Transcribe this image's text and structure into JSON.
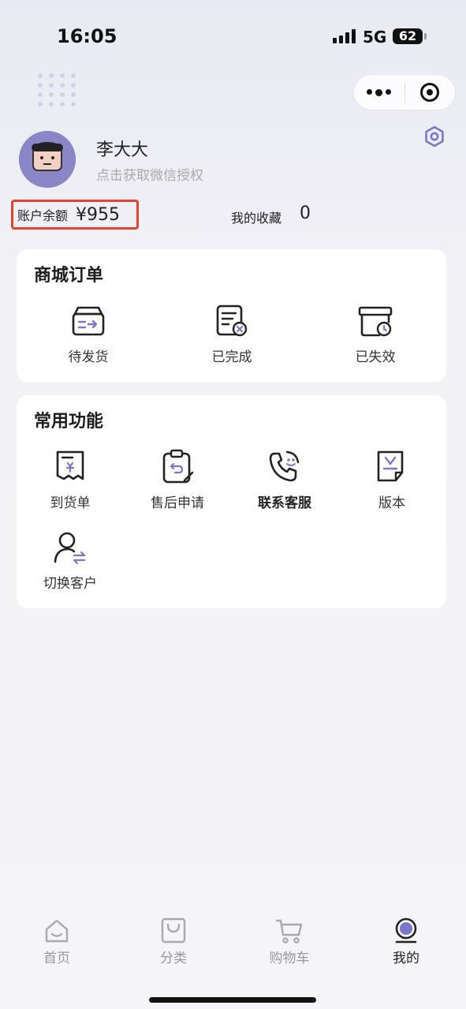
{
  "status_bar": {
    "time": "16:05",
    "network": "5G",
    "battery": "62"
  },
  "profile": {
    "name": "李大大",
    "subtitle": "点击获取微信授权"
  },
  "account": {
    "balance_label": "账户余额",
    "balance_value": "¥955",
    "favorites_label": "我的收藏",
    "favorites_count": "0"
  },
  "orders": {
    "title": "商城订单",
    "items": [
      {
        "label": "待发货",
        "icon": "pending-shipment-icon"
      },
      {
        "label": "已完成",
        "icon": "completed-icon"
      },
      {
        "label": "已失效",
        "icon": "expired-icon"
      }
    ]
  },
  "functions": {
    "title": "常用功能",
    "items": [
      {
        "label": "到货单",
        "icon": "receipt-icon"
      },
      {
        "label": "售后申请",
        "icon": "after-sales-icon"
      },
      {
        "label": "联系客服",
        "icon": "customer-service-icon"
      },
      {
        "label": "版本",
        "icon": "version-icon"
      },
      {
        "label": "切换客户",
        "icon": "switch-customer-icon"
      }
    ]
  },
  "tabbar": {
    "items": [
      {
        "label": "首页",
        "icon": "home-icon"
      },
      {
        "label": "分类",
        "icon": "category-bag-icon"
      },
      {
        "label": "购物车",
        "icon": "cart-icon"
      },
      {
        "label": "我的",
        "icon": "profile-icon"
      }
    ]
  },
  "colors": {
    "accent": "#7b76c8",
    "highlight_box": "#e0432f",
    "text": "#222222"
  }
}
